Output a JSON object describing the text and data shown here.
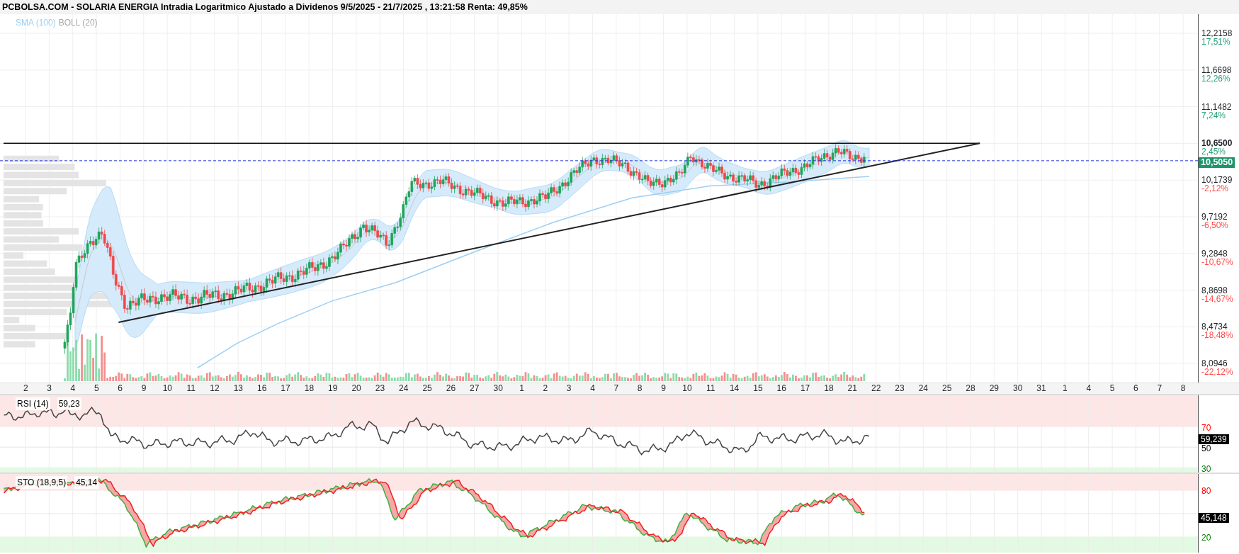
{
  "title": "PCBOLSA.COM - SOLARIA ENERGIA Intradia Logaritmico Ajustado a Dividenos 9/5/2025 - 21/7/2025 , 13:21:58 Renta: 49,85%",
  "legend": [
    {
      "text": "SMA (100)",
      "color": "#9ccff3"
    },
    {
      "text": "BOLL (20)",
      "color": "#a8a8a8"
    }
  ],
  "price_axis": [
    {
      "value": "12,2158",
      "change": "17,51%",
      "color": "#26a17b",
      "emphasized": false
    },
    {
      "value": "11,6698",
      "change": "12,26%",
      "color": "#26a17b",
      "emphasized": false
    },
    {
      "value": "11,1482",
      "change": "7,24%",
      "color": "#26a17b",
      "emphasized": false
    },
    {
      "value": "10,6500",
      "change": "2,45%",
      "color": "#26a17b",
      "emphasized": true
    },
    {
      "value": "10,1739",
      "change": "-2,12%",
      "color": "#ff4a4a",
      "emphasized": false
    },
    {
      "value": "9,7192",
      "change": "-6,50%",
      "color": "#ff4a4a",
      "emphasized": false
    },
    {
      "value": "9,2848",
      "change": "-10,67%",
      "color": "#ff4a4a",
      "emphasized": false
    },
    {
      "value": "8,8698",
      "change": "-14,67%",
      "color": "#ff4a4a",
      "emphasized": false
    },
    {
      "value": "8,4734",
      "change": "-18,48%",
      "color": "#ff4a4a",
      "emphasized": false
    },
    {
      "value": "8,0946",
      "change": "-22,12%",
      "color": "#ff4a4a",
      "emphasized": false
    }
  ],
  "price_tag": "10,5050",
  "dates": [
    "2",
    "3",
    "4",
    "5",
    "6",
    "9",
    "10",
    "11",
    "12",
    "13",
    "16",
    "17",
    "18",
    "19",
    "20",
    "23",
    "24",
    "25",
    "26",
    "27",
    "30",
    "1",
    "2",
    "3",
    "4",
    "7",
    "8",
    "9",
    "10",
    "11",
    "14",
    "15",
    "16",
    "17",
    "18",
    "21",
    "22",
    "23",
    "24",
    "25",
    "28",
    "29",
    "30",
    "31",
    "1",
    "4",
    "5",
    "6",
    "7",
    "8"
  ],
  "rsi": {
    "label": "RSI (14)",
    "value": "59,23",
    "tag": "59,239",
    "levels": [
      {
        "text": "70",
        "color": "#ff0000"
      },
      {
        "text": "50",
        "color": "#000000"
      },
      {
        "text": "30",
        "color": "#008000"
      }
    ]
  },
  "sto": {
    "label": "STO (18,9,5)",
    "value": "45,14",
    "tag": "45,148",
    "levels": [
      {
        "text": "80",
        "color": "#ff0000"
      },
      {
        "text": "20",
        "color": "#008000"
      }
    ]
  }
}
